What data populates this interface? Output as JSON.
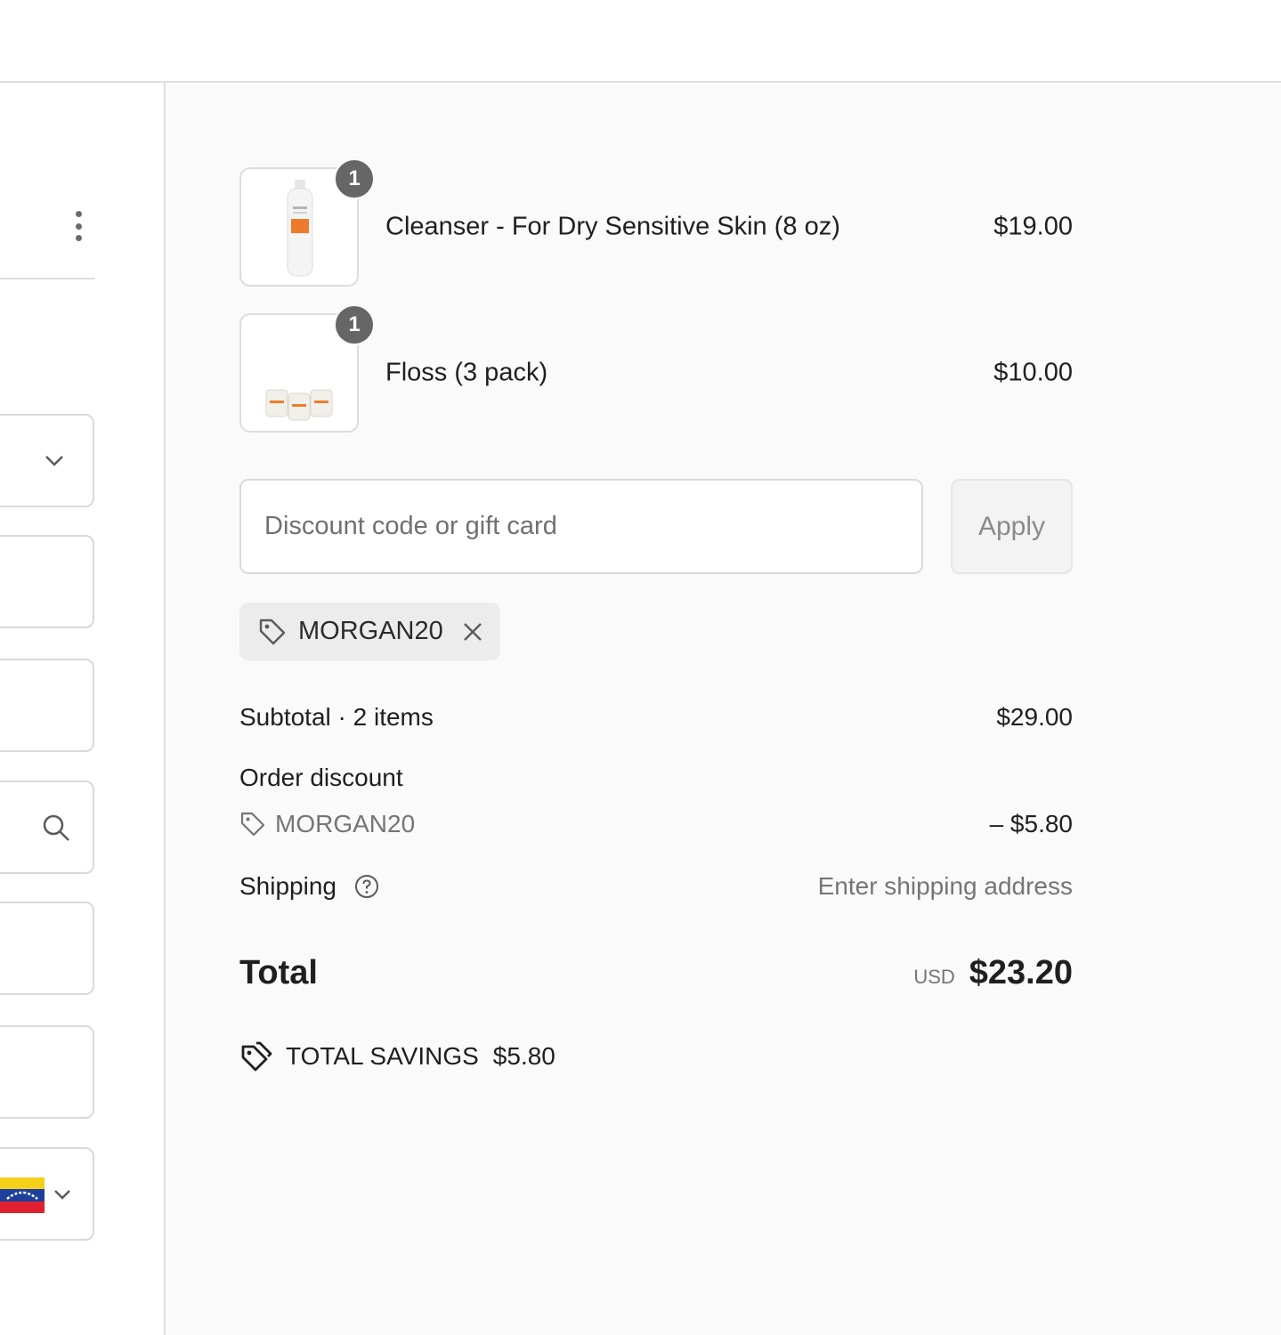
{
  "cart": {
    "items": [
      {
        "name": "Cleanser - For Dry Sensitive Skin (8 oz)",
        "price": "$19.00",
        "quantity": "1",
        "image_icon": "cleanser-bottle-image"
      },
      {
        "name": "Floss (3 pack)",
        "price": "$10.00",
        "quantity": "1",
        "image_icon": "floss-pack-image"
      }
    ]
  },
  "discount": {
    "placeholder": "Discount code or gift card",
    "apply_label": "Apply",
    "applied_code": "MORGAN20"
  },
  "summary": {
    "subtotal_label": "Subtotal · 2 items",
    "subtotal_value": "$29.00",
    "order_discount_label": "Order discount",
    "order_discount_code": "MORGAN20",
    "order_discount_value": "– $5.80",
    "shipping_label": "Shipping",
    "shipping_value": "Enter shipping address",
    "total_label": "Total",
    "total_currency": "USD",
    "total_value": "$23.20",
    "savings_label": "TOTAL SAVINGS",
    "savings_value": "$5.80"
  },
  "colors": {
    "panel_background": "#fafafa",
    "badge": "#666666",
    "border": "#dedede"
  }
}
